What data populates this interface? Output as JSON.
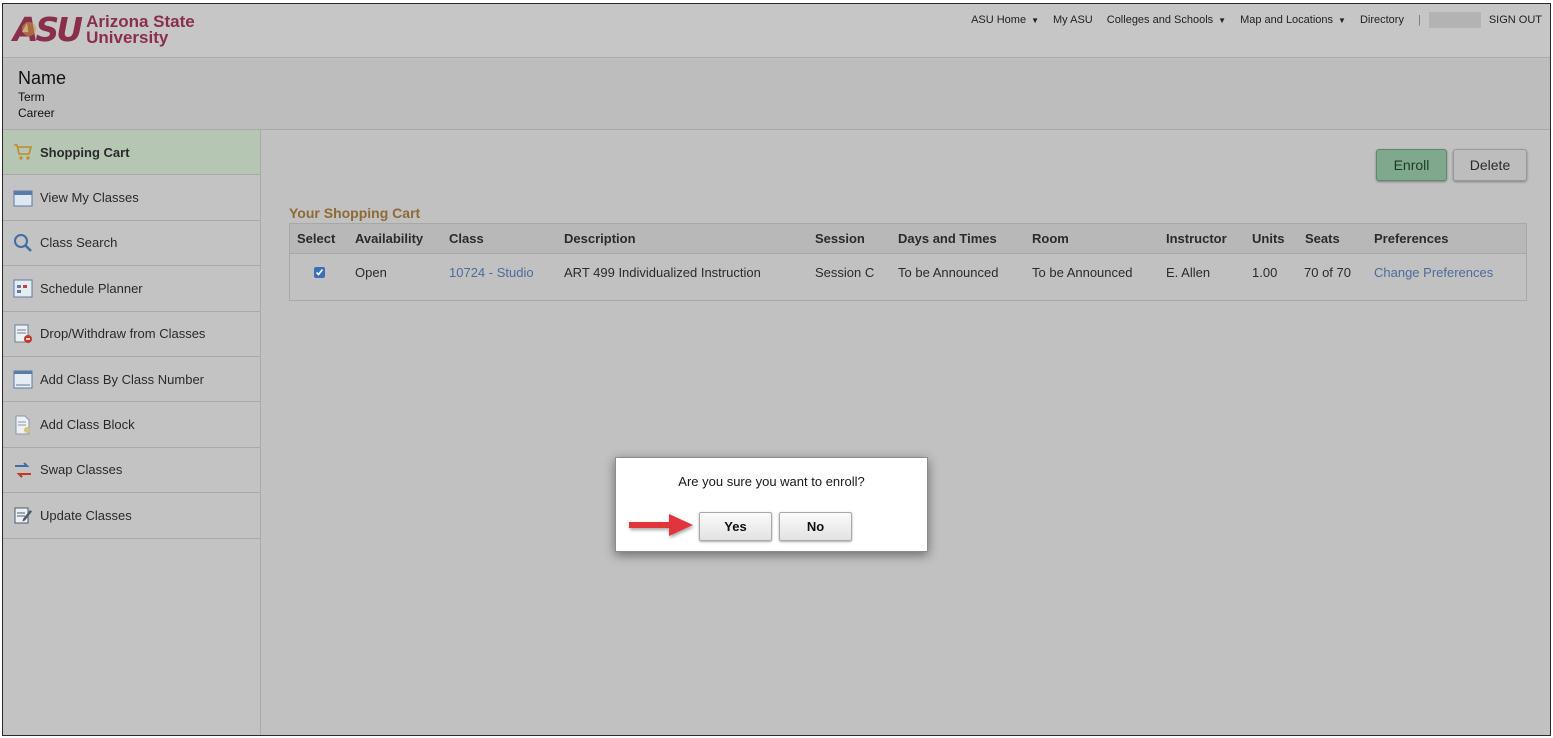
{
  "header": {
    "logo_mark": "ASU",
    "logo_line1": "Arizona State",
    "logo_line2": "University",
    "nav": [
      {
        "label": "ASU Home",
        "dropdown": true
      },
      {
        "label": "My ASU",
        "dropdown": false
      },
      {
        "label": "Colleges and Schools",
        "dropdown": true
      },
      {
        "label": "Map and Locations",
        "dropdown": true
      },
      {
        "label": "Directory",
        "dropdown": false
      }
    ],
    "separator": "|",
    "sign_out": "SIGN OUT"
  },
  "identity": {
    "name": "Name",
    "term": "Term",
    "career": "Career"
  },
  "sidebar": {
    "items": [
      {
        "label": "Shopping Cart",
        "icon": "cart-icon",
        "active": true
      },
      {
        "label": "View My Classes",
        "icon": "calendar-icon"
      },
      {
        "label": "Class Search",
        "icon": "search-icon"
      },
      {
        "label": "Schedule Planner",
        "icon": "planner-icon"
      },
      {
        "label": "Drop/Withdraw from Classes",
        "icon": "drop-icon"
      },
      {
        "label": "Add Class By Class Number",
        "icon": "calendar-add-icon"
      },
      {
        "label": "Add Class Block",
        "icon": "document-icon"
      },
      {
        "label": "Swap Classes",
        "icon": "swap-arrows-icon"
      },
      {
        "label": "Update Classes",
        "icon": "edit-icon"
      }
    ]
  },
  "actions": {
    "enroll": "Enroll",
    "delete": "Delete"
  },
  "cart": {
    "title": "Your Shopping Cart",
    "columns": [
      "Select",
      "Availability",
      "Class",
      "Description",
      "Session",
      "Days and Times",
      "Room",
      "Instructor",
      "Units",
      "Seats",
      "Preferences"
    ],
    "rows": [
      {
        "selected": true,
        "availability": "Open",
        "class": "10724 - Studio",
        "description": "ART 499 Individualized Instruction",
        "session": "Session C",
        "days_times": "To be Announced",
        "room": "To be Announced",
        "instructor": "E. Allen",
        "units": "1.00",
        "seats": "70 of 70",
        "preferences": "Change Preferences"
      }
    ]
  },
  "dialog": {
    "question": "Are you sure you want to enroll?",
    "yes": "Yes",
    "no": "No"
  },
  "colors": {
    "brand_maroon": "#8a2f4b",
    "brand_gold": "#c79a3a",
    "enroll_green": "#7fa88c",
    "link_blue": "#4b6c9e",
    "cart_title": "#8d6a36",
    "annotation_arrow": "#e0343b"
  }
}
